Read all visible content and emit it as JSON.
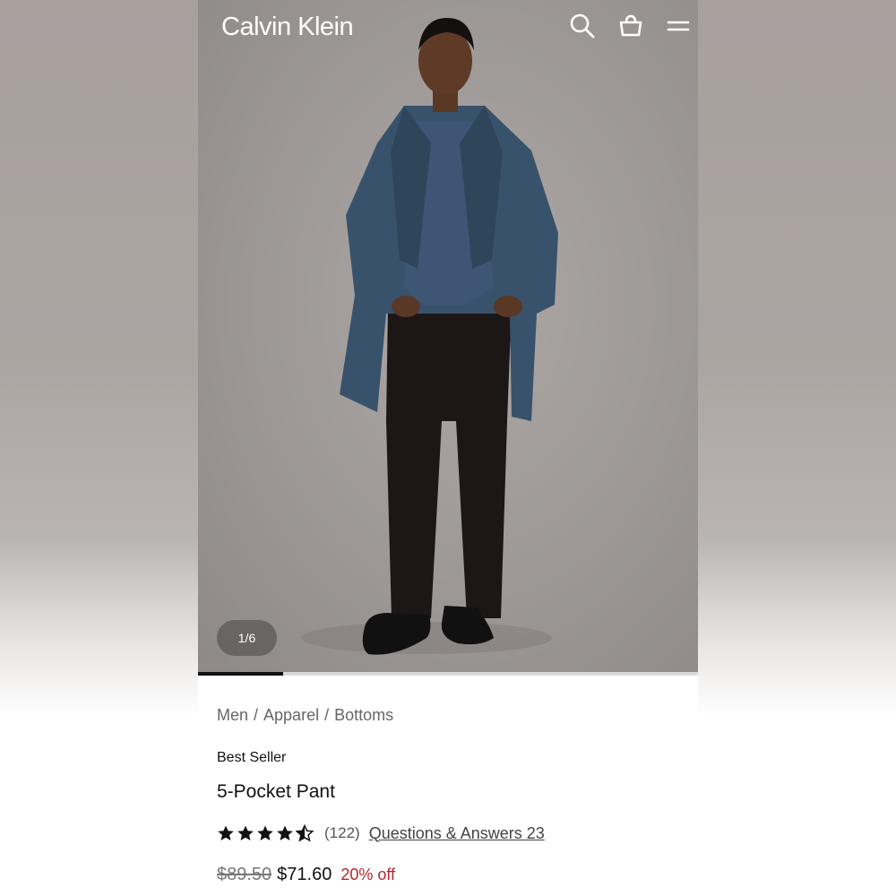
{
  "header": {
    "brand": "Calvin Klein",
    "icons": [
      "search-icon",
      "bag-icon",
      "menu-icon"
    ]
  },
  "gallery": {
    "counter": "1/6",
    "progress_fraction": 0.17
  },
  "breadcrumb": [
    "Men",
    "Apparel",
    "Bottoms"
  ],
  "product": {
    "badge": "Best Seller",
    "title": "5-Pocket Pant",
    "rating": 4.5,
    "rating_max": 5,
    "review_count": "(122)",
    "qa_link": "Questions & Answers 23",
    "original_price": "$89.50",
    "sale_price": "$71.60",
    "discount": "20% off"
  },
  "colors": {
    "accent_red": "#b0272d",
    "text": "#111111",
    "muted": "#666666"
  }
}
